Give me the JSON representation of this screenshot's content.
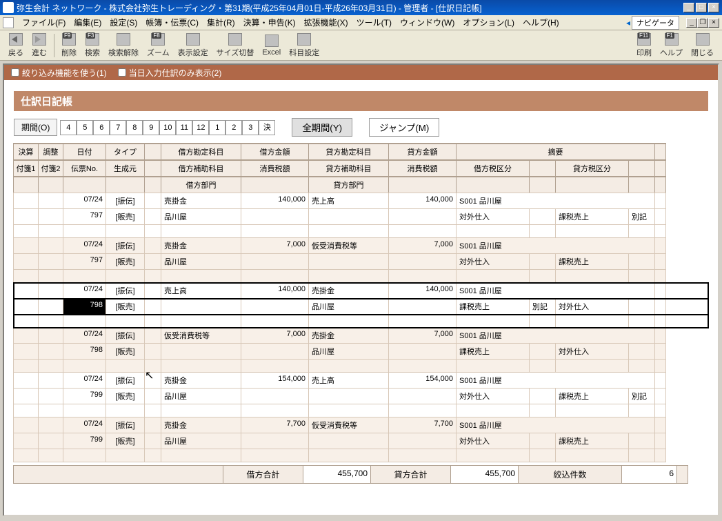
{
  "window": {
    "title": "弥生会計 ネットワーク - 株式会社弥生トレーディング・第31期(平成25年04月01日-平成26年03月31日) - 管理者 - [仕訳日記帳]"
  },
  "menubar": {
    "items": [
      "ファイル(F)",
      "編集(E)",
      "設定(S)",
      "帳簿・伝票(C)",
      "集計(R)",
      "決算・申告(K)",
      "拡張機能(X)",
      "ツール(T)",
      "ウィンドウ(W)",
      "オプション(L)",
      "ヘルプ(H)"
    ],
    "navigator": "ナビゲータ"
  },
  "toolbar": {
    "buttons": [
      {
        "label": "戻る",
        "icon": "back"
      },
      {
        "label": "進む",
        "icon": "forward"
      },
      {
        "label": "削除",
        "key": "F9",
        "icon": "delete"
      },
      {
        "label": "検索",
        "key": "F3",
        "icon": "search"
      },
      {
        "label": "検索解除",
        "icon": "search-clear"
      },
      {
        "label": "ズーム",
        "key": "F8",
        "icon": "zoom"
      },
      {
        "label": "表示設定",
        "icon": "display"
      },
      {
        "label": "サイズ切替",
        "icon": "size"
      },
      {
        "label": "Excel",
        "icon": "excel"
      },
      {
        "label": "科目設定",
        "icon": "account"
      }
    ],
    "right": [
      {
        "label": "印刷",
        "key": "F11",
        "icon": "print"
      },
      {
        "label": "ヘルプ",
        "key": "F1",
        "icon": "help"
      },
      {
        "label": "閉じる",
        "icon": "close"
      }
    ]
  },
  "options": {
    "filter": "絞り込み機能を使う(1)",
    "today": "当日入力仕訳のみ表示(2)"
  },
  "doc": {
    "title": "仕訳日記帳"
  },
  "period": {
    "label": "期間(O)",
    "months": [
      "4",
      "5",
      "6",
      "7",
      "8",
      "9",
      "10",
      "11",
      "12",
      "1",
      "2",
      "3",
      "決"
    ],
    "full": "全期間(Y)",
    "jump": "ジャンプ(M)"
  },
  "headers": {
    "r1": [
      "決算",
      "調整",
      "日付",
      "タイプ",
      "",
      "借方勘定科目",
      "借方金額",
      "貸方勘定科目",
      "貸方金額",
      "摘要",
      "",
      "",
      "",
      ""
    ],
    "r2": [
      "付箋1",
      "付箋2",
      "伝票No.",
      "生成元",
      "",
      "借方補助科目",
      "消費税額",
      "貸方補助科目",
      "消費税額",
      "借方税区分",
      "",
      "貸方税区分",
      "",
      ""
    ],
    "r3": [
      "",
      "",
      "",
      "",
      "",
      "借方部門",
      "",
      "貸方部門",
      "",
      "",
      "",
      "",
      "",
      ""
    ]
  },
  "entries": [
    {
      "date": "07/24",
      "type": "[振伝]",
      "slip": "797",
      "src": "[販売]",
      "drAcct": "売掛金",
      "drAux": "品川屋",
      "drAmt": "140,000",
      "crAcct": "売上高",
      "crAmt": "140,000",
      "summary": "S001 品川屋",
      "drTax": "対外仕入",
      "crTax": "課税売上",
      "note": "別記",
      "selected": false
    },
    {
      "date": "07/24",
      "type": "[振伝]",
      "slip": "797",
      "src": "[販売]",
      "drAcct": "売掛金",
      "drAux": "品川屋",
      "drAmt": "7,000",
      "crAcct": "仮受消費税等",
      "crAmt": "7,000",
      "summary": "S001 品川屋",
      "drTax": "対外仕入",
      "crTax": "課税売上",
      "note": "",
      "selected": false
    },
    {
      "date": "07/24",
      "type": "[振伝]",
      "slip": "798",
      "src": "[販売]",
      "drAcct": "売上高",
      "drAux": "",
      "drAmt": "140,000",
      "crAcct": "売掛金",
      "crAux": "品川屋",
      "crAmt": "140,000",
      "summary": "S001 品川屋",
      "drTax": "課税売上",
      "drNote": "別記",
      "crTax": "対外仕入",
      "selected": true
    },
    {
      "date": "07/24",
      "type": "[振伝]",
      "slip": "798",
      "src": "[販売]",
      "drAcct": "仮受消費税等",
      "drAux": "",
      "drAmt": "7,000",
      "crAcct": "売掛金",
      "crAux": "品川屋",
      "crAmt": "7,000",
      "summary": "S001 品川屋",
      "drTax": "課税売上",
      "crTax": "対外仕入",
      "selected": false
    },
    {
      "date": "07/24",
      "type": "[振伝]",
      "slip": "799",
      "src": "[販売]",
      "drAcct": "売掛金",
      "drAux": "品川屋",
      "drAmt": "154,000",
      "crAcct": "売上高",
      "crAmt": "154,000",
      "summary": "S001 品川屋",
      "drTax": "対外仕入",
      "crTax": "課税売上",
      "note": "別記",
      "selected": false
    },
    {
      "date": "07/24",
      "type": "[振伝]",
      "slip": "799",
      "src": "[販売]",
      "drAcct": "売掛金",
      "drAux": "品川屋",
      "drAmt": "7,700",
      "crAcct": "仮受消費税等",
      "crAmt": "7,700",
      "summary": "S001 品川屋",
      "drTax": "対外仕入",
      "crTax": "課税売上",
      "note": "",
      "selected": false
    }
  ],
  "footer": {
    "drLabel": "借方合計",
    "drTotal": "455,700",
    "crLabel": "貸方合計",
    "crTotal": "455,700",
    "countLabel": "絞込件数",
    "count": "6"
  }
}
